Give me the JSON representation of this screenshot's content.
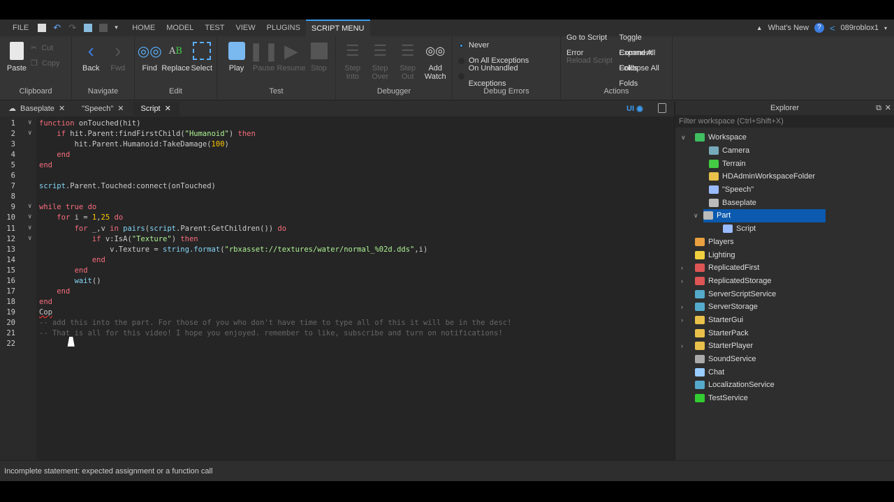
{
  "menubar": {
    "file": "FILE",
    "tabs": [
      "HOME",
      "MODEL",
      "TEST",
      "VIEW",
      "PLUGINS",
      "SCRIPT MENU"
    ],
    "whats_new": "What's New",
    "user": "089roblox1"
  },
  "ribbon": {
    "clipboard": {
      "paste": "Paste",
      "cut": "Cut",
      "copy": "Copy",
      "label": "Clipboard"
    },
    "navigate": {
      "back": "Back",
      "fwd": "Fwd",
      "label": "Navigate"
    },
    "edit": {
      "find": "Find",
      "replace": "Replace",
      "select": "Select",
      "label": "Edit"
    },
    "test": {
      "play": "Play",
      "pause": "Pause",
      "resume": "Resume",
      "stop": "Stop",
      "label": "Test"
    },
    "debugger": {
      "step_into": [
        "Step",
        "Into"
      ],
      "step_over": [
        "Step",
        "Over"
      ],
      "step_out": [
        "Step",
        "Out"
      ],
      "add_watch": [
        "Add",
        "Watch"
      ],
      "label": "Debugger"
    },
    "debug_errors": {
      "options": [
        "Never",
        "On All Exceptions",
        "On Unhandled Exceptions"
      ],
      "selected": "Never",
      "label": "Debug Errors"
    },
    "actions": {
      "goto": "Go to Script Error",
      "reload": "Reload Script",
      "toggle": "Toggle Comment",
      "expand": "Expand All Folds",
      "collapse": "Collapse All Folds",
      "label": "Actions"
    }
  },
  "doc_tabs": [
    "Baseplate",
    "\"Speech\"",
    "Script"
  ],
  "editor_ui_label": "UI",
  "code": [
    [
      [
        "function",
        "kw"
      ],
      " onTouched(hit)"
    ],
    [
      "    ",
      [
        "if",
        "kw"
      ],
      " hit.Parent:findFirstChild(",
      [
        "\"Humanoid\"",
        "st"
      ],
      ") ",
      [
        "then",
        "kw"
      ]
    ],
    [
      "        hit.Parent.Humanoid:TakeDamage(",
      [
        "100",
        "nu"
      ],
      ")"
    ],
    [
      "    ",
      [
        "end",
        "kw"
      ]
    ],
    [
      [
        "end",
        "kw"
      ]
    ],
    [
      ""
    ],
    [
      [
        "script",
        "bi"
      ],
      ".Parent.Touched:connect(onTouched)"
    ],
    [
      ""
    ],
    [
      [
        "while",
        "kw"
      ],
      " ",
      [
        "true",
        "kw"
      ],
      " ",
      [
        "do",
        "kw"
      ]
    ],
    [
      "    ",
      [
        "for",
        "kw"
      ],
      " i = ",
      [
        "1",
        "nu"
      ],
      ",",
      [
        "25",
        "nu"
      ],
      " ",
      [
        "do",
        "kw"
      ]
    ],
    [
      "        ",
      [
        "for",
        "kw"
      ],
      " _,v ",
      [
        "in",
        "kw"
      ],
      " ",
      [
        "pairs",
        "bi"
      ],
      "(",
      [
        "script",
        "bi"
      ],
      ".Parent:GetChildren()) ",
      [
        "do",
        "kw"
      ]
    ],
    [
      "            ",
      [
        "if",
        "kw"
      ],
      " v:IsA(",
      [
        "\"Texture\"",
        "st"
      ],
      ") ",
      [
        "then",
        "kw"
      ]
    ],
    [
      "                v.Texture = ",
      [
        "string.format",
        "bi"
      ],
      "(",
      [
        "\"rbxasset://textures/water/normal_%02d.dds\"",
        "st"
      ],
      ",i)"
    ],
    [
      "            ",
      [
        "end",
        "kw"
      ]
    ],
    [
      "        ",
      [
        "end",
        "kw"
      ]
    ],
    [
      "        ",
      [
        "wait",
        "bi"
      ],
      "()"
    ],
    [
      "    ",
      [
        "end",
        "kw"
      ]
    ],
    [
      [
        "end",
        "kw"
      ]
    ],
    [
      [
        "Cop",
        "er"
      ]
    ],
    [
      [
        "-- add this into the part. For those of you who don't have time to type all of this it will be in the desc!",
        "cm"
      ]
    ],
    [
      [
        "-- That is all for this video! I hope you enjoyed. remember to like, subscribe and turn on notifications!",
        "cm"
      ]
    ],
    [
      ""
    ]
  ],
  "folds": [
    1,
    2,
    9,
    10,
    11,
    12
  ],
  "status": "Incomplete statement: expected assignment or a function call",
  "explorer": {
    "title": "Explorer",
    "filter_placeholder": "Filter workspace (Ctrl+Shift+X)",
    "items": [
      {
        "label": "Workspace",
        "depth": 0,
        "arrow": "open",
        "color": "#3fbf5f"
      },
      {
        "label": "Camera",
        "depth": 1,
        "color": "#7ab"
      },
      {
        "label": "Terrain",
        "depth": 1,
        "color": "#4c4"
      },
      {
        "label": "HDAdminWorkspaceFolder",
        "depth": 1,
        "color": "#e8c04a"
      },
      {
        "label": "\"Speech\"",
        "depth": 1,
        "color": "#9bf"
      },
      {
        "label": "Baseplate",
        "depth": 1,
        "color": "#bbb"
      },
      {
        "label": "Part",
        "depth": 1,
        "arrow": "open",
        "color": "#bbb",
        "selected": true
      },
      {
        "label": "Script",
        "depth": 2,
        "color": "#9bf"
      },
      {
        "label": "Players",
        "depth": 0,
        "color": "#e8a040"
      },
      {
        "label": "Lighting",
        "depth": 0,
        "color": "#f0d040"
      },
      {
        "label": "ReplicatedFirst",
        "depth": 0,
        "arrow": "closed",
        "color": "#d55"
      },
      {
        "label": "ReplicatedStorage",
        "depth": 0,
        "arrow": "closed",
        "color": "#d55"
      },
      {
        "label": "ServerScriptService",
        "depth": 0,
        "color": "#5ac"
      },
      {
        "label": "ServerStorage",
        "depth": 0,
        "arrow": "closed",
        "color": "#5ac"
      },
      {
        "label": "StarterGui",
        "depth": 0,
        "arrow": "closed",
        "color": "#e8c04a"
      },
      {
        "label": "StarterPack",
        "depth": 0,
        "color": "#e8c04a"
      },
      {
        "label": "StarterPlayer",
        "depth": 0,
        "arrow": "closed",
        "color": "#e8c04a"
      },
      {
        "label": "SoundService",
        "depth": 0,
        "color": "#aaa"
      },
      {
        "label": "Chat",
        "depth": 0,
        "color": "#9cf"
      },
      {
        "label": "LocalizationService",
        "depth": 0,
        "color": "#5ac"
      },
      {
        "label": "TestService",
        "depth": 0,
        "color": "#3c3"
      }
    ]
  }
}
